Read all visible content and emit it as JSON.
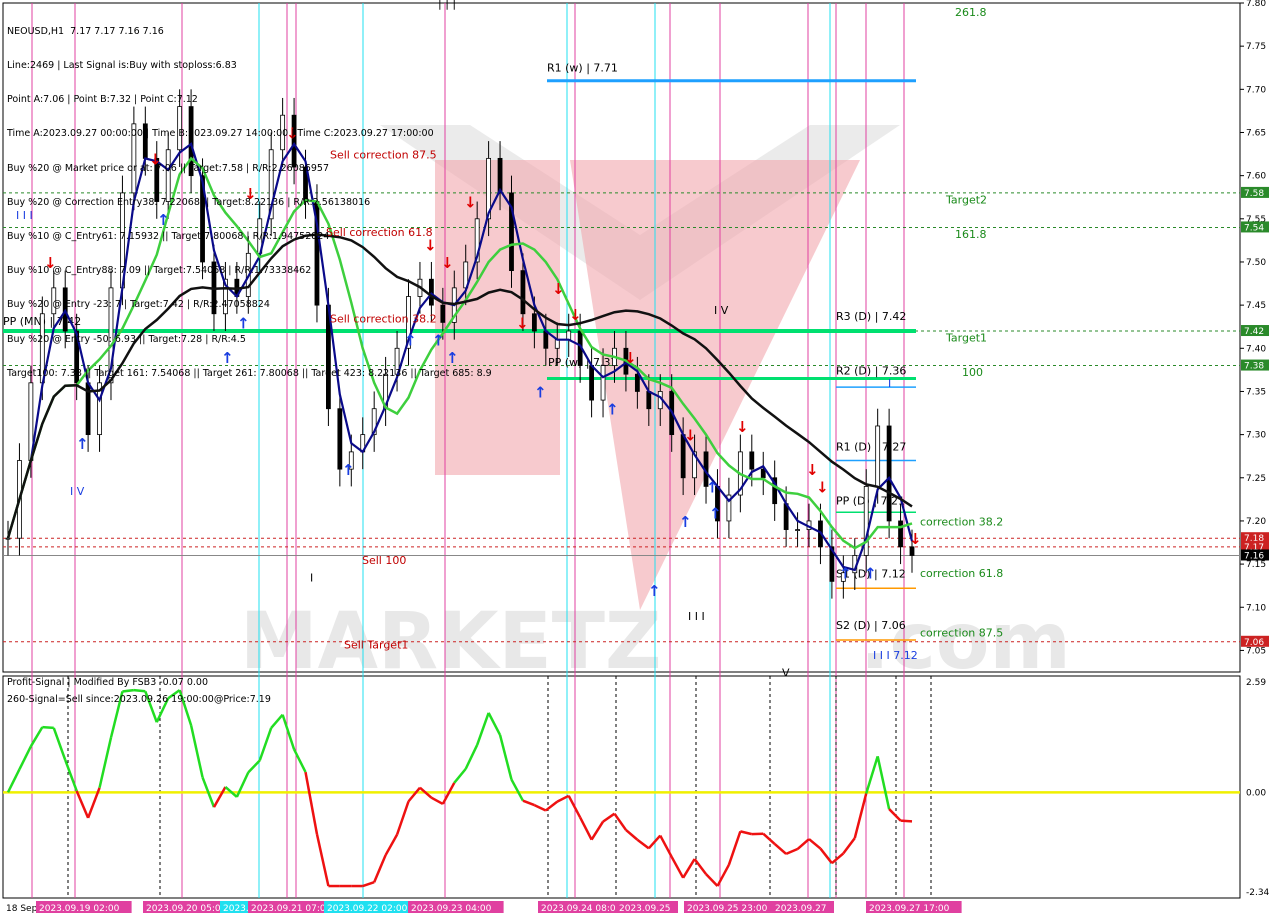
{
  "header": {
    "lines": [
      "NEOUSD,H1  7.17 7.17 7.16 7.16",
      "Line:2469 | Last Signal is:Buy with stoploss:6.83",
      "Point A:7.06 | Point B:7.32 | Point C:7.12",
      "Time A:2023.09.27 00:00:00 | Time B:2023.09.27 14:00:00 | Time C:2023.09.27 17:00:00",
      "Buy %20 @ Market price or at: 7.06 || Target:7.58 | R/R:2.26086957",
      "Buy %20 @ Correction Entry38: 7.22068 || Target:8.22136 | R/R:2.56138016",
      "Buy %10 @ C_Entry61: 7.15932 || Target:7.80068 | R/R:1.94752824",
      "Buy %10 @ C_Entry88: 7.09 || Target:7.54068 | R/R:1.73338462",
      "Buy %20 @ Entry -23: 7 | Target:7.42 | R/R:2.47058824",
      "Buy %20 @ Entry -50: 6.93 || Target:7.28 | R/R:4.5",
      "Target100: 7.38 || Target 161: 7.54068 || Target 261: 7.80068 || Target 423: 8.22136 || Target 685: 8.9"
    ]
  },
  "colors": {
    "bg": "#ffffff",
    "green_level": "#00e070",
    "cyan_level": "#1ea0ff",
    "red_text": "#c00000",
    "green_text": "#1a8a1a",
    "ma_fast": "#0a0a8a",
    "ma_mid": "#3ecf3e",
    "ma_slow": "#111111",
    "osc_up": "#22dd22",
    "osc_down": "#ee1111",
    "zero_line": "#f0f000",
    "vline_cyan": "#20e0f0",
    "vline_magenta": "#e040a0",
    "watermark": "#e8e8e8",
    "red_triangle": "#f2a6ae"
  },
  "main_axis": {
    "ticks": [
      "7.80",
      "7.75",
      "7.70",
      "7.65",
      "7.60",
      "7.55",
      "7.50",
      "7.45",
      "7.40",
      "7.35",
      "7.30",
      "7.25",
      "7.20",
      "7.15",
      "7.10",
      "7.05"
    ],
    "ylim": [
      7.025,
      7.8
    ]
  },
  "price_tags": [
    {
      "label": "7.58",
      "value": 7.58,
      "color": "#2a8a2a"
    },
    {
      "label": "7.54",
      "value": 7.54,
      "color": "#2a8a2a"
    },
    {
      "label": "7.42",
      "value": 7.42,
      "color": "#2a8a2a"
    },
    {
      "label": "7.38",
      "value": 7.38,
      "color": "#2a8a2a"
    },
    {
      "label": "7.18",
      "value": 7.18,
      "color": "#cc2222"
    },
    {
      "label": "7.17",
      "value": 7.17,
      "color": "#cc2222"
    },
    {
      "label": "7.16",
      "value": 7.16,
      "color": "#000000"
    },
    {
      "label": "7.06",
      "value": 7.06,
      "color": "#cc2222"
    }
  ],
  "levels": [
    {
      "label": "R1 (w) | 7.71",
      "value": 7.71,
      "color": "#1ea0ff",
      "width": 3
    },
    {
      "label": "PP (MN) | 7.42",
      "value": 7.42,
      "color": "#00e070",
      "width": 4
    },
    {
      "label": "R3 (D) | 7.42",
      "value": 7.42,
      "color": "#00e070",
      "width": 0
    },
    {
      "label": "R2 (D) | 7.36",
      "value": 7.365,
      "color": "#00e070",
      "width": 3
    },
    {
      "label": "R1 (D) | 7.27",
      "value": 7.27,
      "color": "#1ea0ff",
      "width": 1
    },
    {
      "label": "PP (D) | 7.21",
      "value": 7.21,
      "color": "#00e070",
      "width": 1
    },
    {
      "label": "S1 (D) | 7.12",
      "value": 7.122,
      "color": "#ff9900",
      "width": 1
    },
    {
      "label": "S2 (D) | 7.06",
      "value": 7.062,
      "color": "#ff9900",
      "width": 1
    },
    {
      "label": "PP (w) | 7.37",
      "value": 7.37,
      "color": "#00e070",
      "width": 0
    }
  ],
  "annotations": {
    "sell_corr_875": "Sell correction 87.5",
    "sell_corr_618": "Sell correction 61.8",
    "sell_corr_38": "Sell correction 38.2",
    "sell_100": "Sell 100",
    "sell_target1": "Sell  Target1",
    "target2": "Target2",
    "target1": "Target1",
    "fib_2618": "261.8",
    "fib_1618": "161.8",
    "fib_100": "100",
    "corr_382": "correction 38.2",
    "corr_618": "correction 61.8",
    "corr_875": "correction 87.5",
    "wave_iii_top": "| | |",
    "wave_iv_left": "I V",
    "wave_iv_mid": "I V",
    "wave_i_right": "I",
    "wave_iii_low": "I I I",
    "wave_v": "V",
    "wave_iii_price": "I I I 7.12",
    "wave_i_mid": "I"
  },
  "oscillator": {
    "title": "Profit-Signal | Modified By FSB3 -0.07 0.00",
    "signal": "260-Signal=Sell since:2023.09.26 19:00:00@Price:7.19",
    "ticks": [
      "2.59",
      "0.00",
      "-2.34"
    ],
    "ylim": [
      -2.34,
      2.59
    ]
  },
  "time_axis": [
    {
      "label": "18 Sep 2023",
      "hl": ""
    },
    {
      "label": "2023.09.19 02:00",
      "hl": "#e040a0"
    },
    {
      "label": "2023.09.20 05:00",
      "hl": "#e040a0"
    },
    {
      "label": "2023.",
      "hl": "#20e0f0"
    },
    {
      "label": "2023.09.21 07:00",
      "hl": "#e040a0"
    },
    {
      "label": "2023.09.22 02:00",
      "hl": "#20e0f0"
    },
    {
      "label": "2023.09.23 04:00",
      "hl": "#e040a0"
    },
    {
      "label": "2023.09.24 08:00",
      "hl": "#e040a0"
    },
    {
      "label": "2023.09.25",
      "hl": "#e040a0"
    },
    {
      "label": "2023.09.25 23:00",
      "hl": "#e040a0"
    },
    {
      "label": "2023.09.27",
      "hl": "#e040a0"
    },
    {
      "label": "2023.09.27 17:00",
      "hl": "#e040a0"
    }
  ],
  "chart_data": {
    "type": "line",
    "title": "NEOUSD,H1",
    "series": [
      {
        "name": "price",
        "values": [
          7.18,
          7.27,
          7.36,
          7.44,
          7.47,
          7.42,
          7.36,
          7.3,
          7.36,
          7.47,
          7.58,
          7.66,
          7.62,
          7.57,
          7.63,
          7.68,
          7.6,
          7.5,
          7.44,
          7.48,
          7.46,
          7.51,
          7.55,
          7.63,
          7.67,
          7.61,
          7.57,
          7.45,
          7.33,
          7.26,
          7.28,
          7.3,
          7.33,
          7.37,
          7.4,
          7.46,
          7.48,
          7.45,
          7.43,
          7.47,
          7.5,
          7.55,
          7.62,
          7.58,
          7.49,
          7.44,
          7.42,
          7.4,
          7.41,
          7.42,
          7.38,
          7.34,
          7.38,
          7.4,
          7.37,
          7.35,
          7.33,
          7.35,
          7.3,
          7.25,
          7.28,
          7.24,
          7.2,
          7.23,
          7.28,
          7.26,
          7.25,
          7.22,
          7.19,
          7.19,
          7.2,
          7.17,
          7.13,
          7.14,
          7.16,
          7.24,
          7.31,
          7.2,
          7.17,
          7.16
        ]
      }
    ],
    "ylim": [
      7.025,
      7.8
    ]
  }
}
